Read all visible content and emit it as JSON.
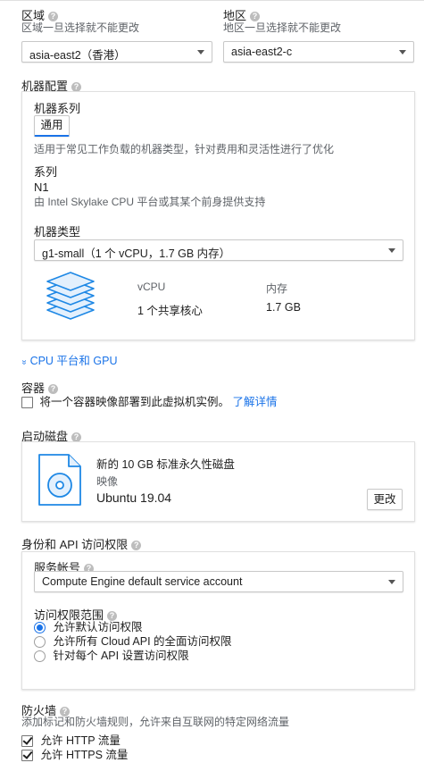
{
  "region": {
    "title": "区域",
    "hint": "区域一旦选择就不能更改",
    "value": "asia-east2（香港）"
  },
  "zone": {
    "title": "地区",
    "hint": "地区一旦选择就不能更改",
    "value": "asia-east2-c"
  },
  "machine_config": {
    "title": "机器配置",
    "family_label": "机器系列",
    "family_tab": "通用",
    "family_desc": "适用于常见工作负载的机器类型，针对费用和灵活性进行了优化",
    "series_label": "系列",
    "series_value": "N1",
    "series_desc": "由 Intel Skylake CPU 平台或其某个前身提供支持",
    "type_label": "机器类型",
    "type_value": "g1-small（1 个 vCPU，1.7 GB 内存）",
    "vcpu_header": "vCPU",
    "memory_header": "内存",
    "vcpu_value": "1 个共享核心",
    "memory_value": "1.7 GB",
    "icon": "stacked-layers-icon"
  },
  "cpu_gpu": {
    "label": "CPU 平台和 GPU"
  },
  "container": {
    "title": "容器",
    "checkbox_label": "将一个容器映像部署到此虚拟机实例。",
    "learn_more": "了解详情",
    "checked": false
  },
  "boot_disk": {
    "title": "启动磁盘",
    "disk_name": "新的 10 GB 标准永久性磁盘",
    "image_label": "映像",
    "image_value": "Ubuntu 19.04",
    "change_button": "更改",
    "icon": "disk-file-icon"
  },
  "identity": {
    "title": "身份和 API 访问权限",
    "service_account_label": "服务帐号",
    "service_account_value": "Compute Engine default service account",
    "scope_label": "访问权限范围",
    "scopes": [
      {
        "label": "允许默认访问权限",
        "selected": true
      },
      {
        "label": "允许所有 Cloud API 的全面访问权限",
        "selected": false
      },
      {
        "label": "针对每个 API 设置访问权限",
        "selected": false
      }
    ]
  },
  "firewall": {
    "title": "防火墙",
    "hint": "添加标记和防火墙规则，允许来自互联网的特定网络流量",
    "options": [
      {
        "label": "允许 HTTP 流量",
        "checked": true
      },
      {
        "label": "允许 HTTPS 流量",
        "checked": true
      }
    ]
  },
  "colors": {
    "accent": "#1a73e8",
    "tab_underline": "#1a73e8",
    "icon_blue": "#1e88e5",
    "border": "#e0e0e0"
  }
}
